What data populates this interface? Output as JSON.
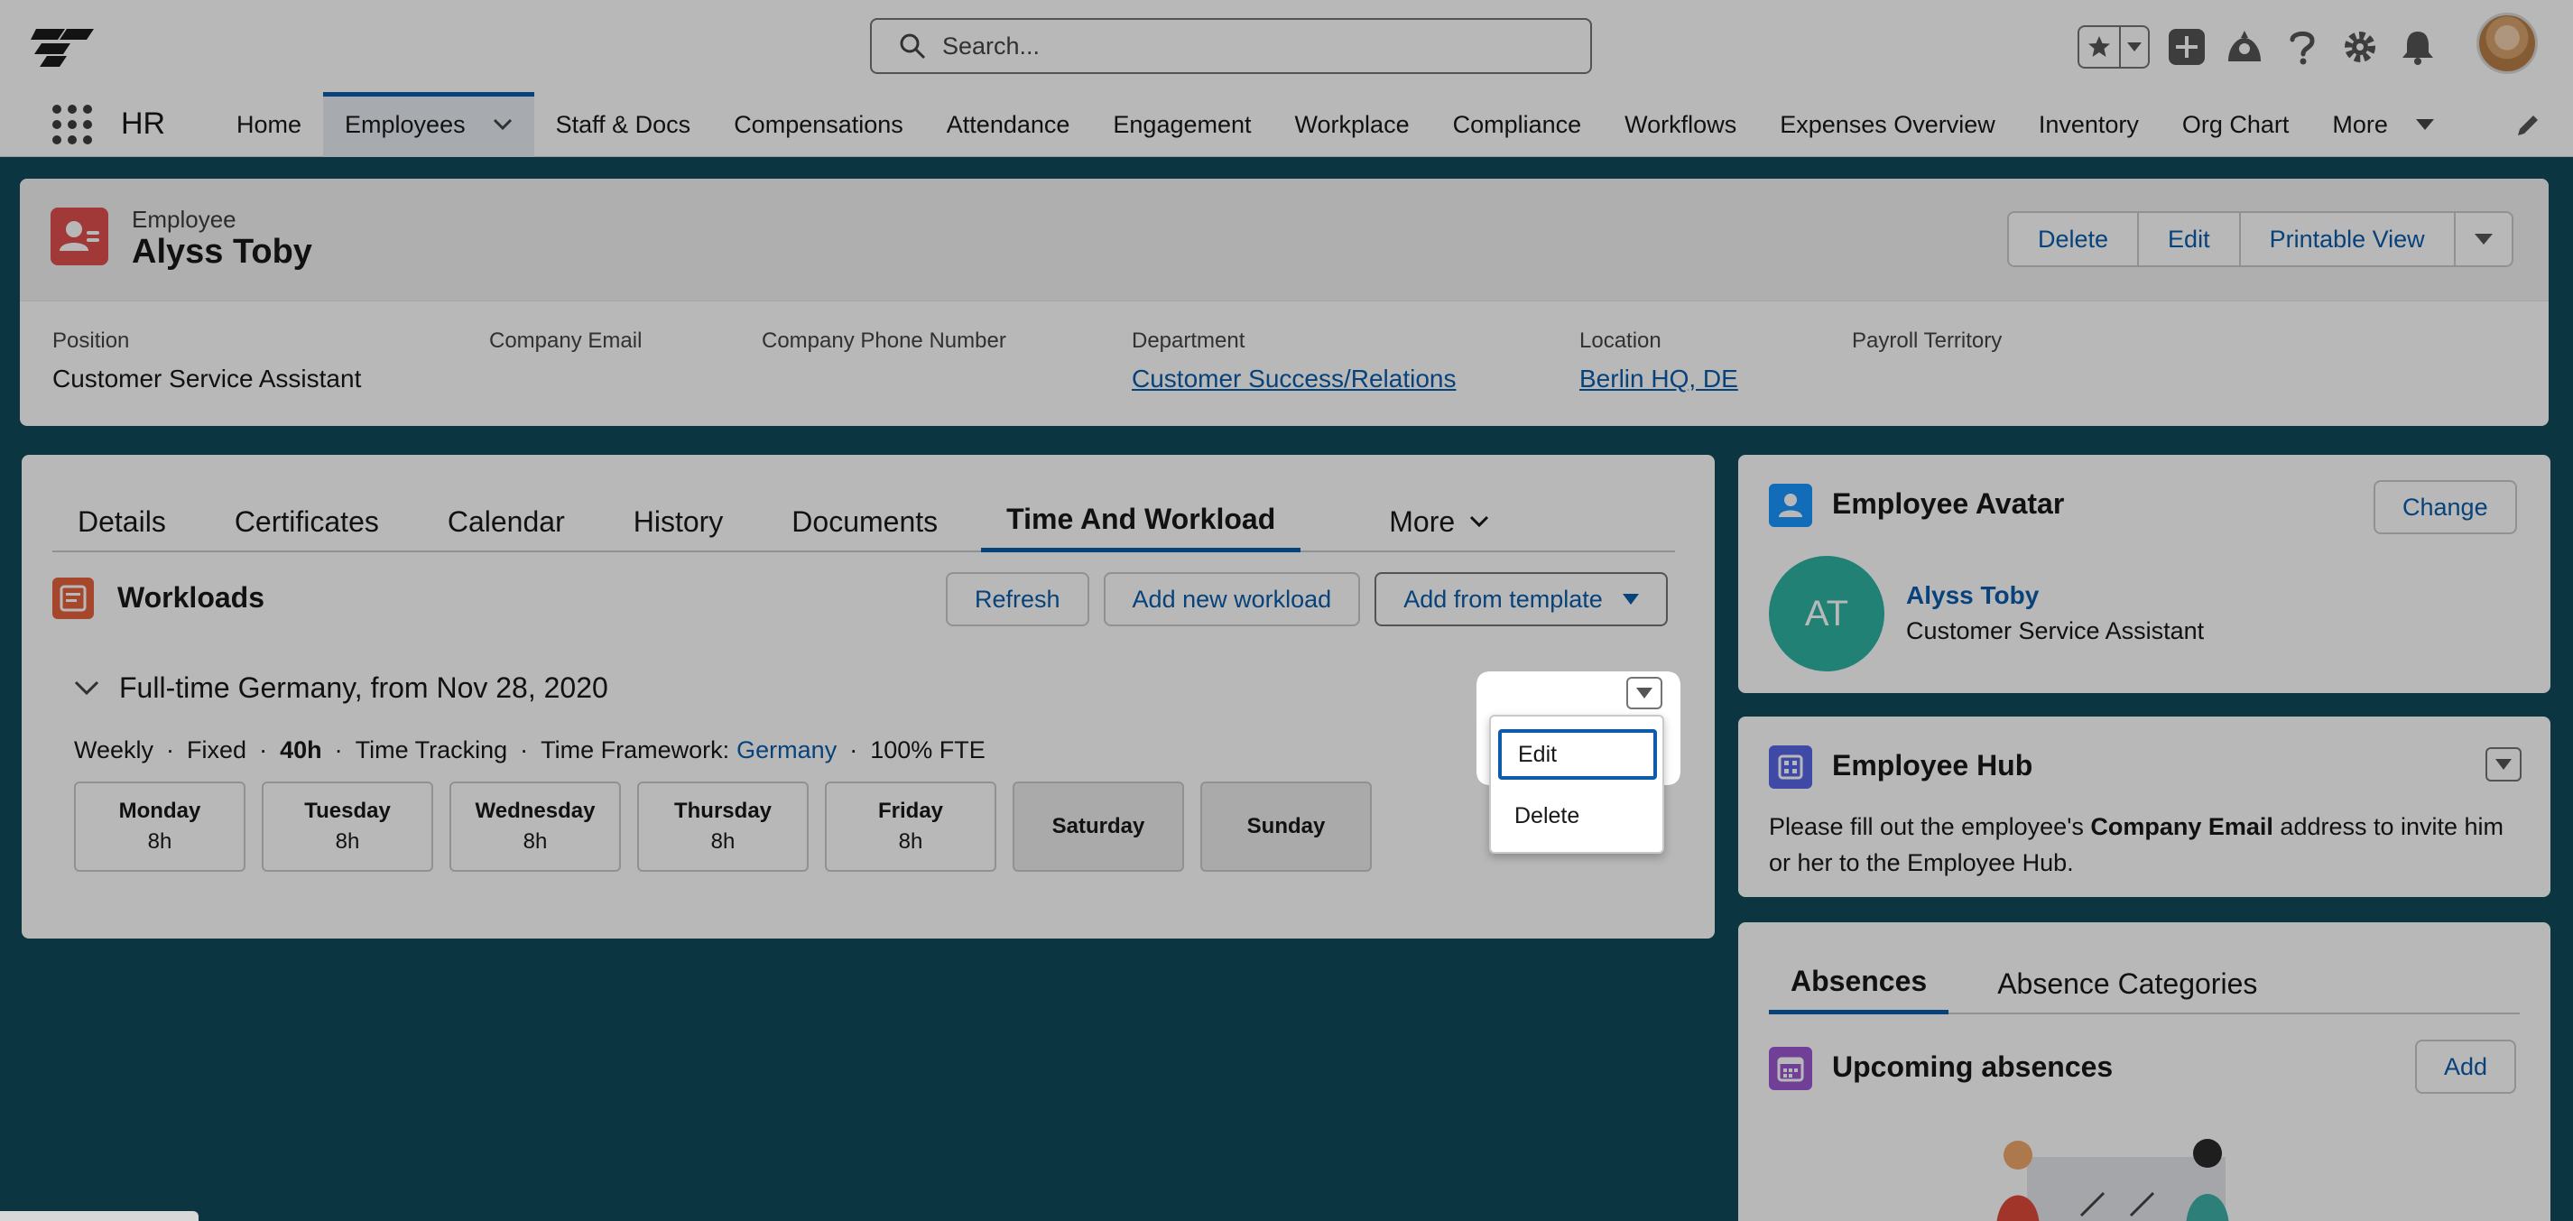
{
  "header": {
    "search_placeholder": "Search...",
    "icons": [
      "favorites-star-icon",
      "add-icon",
      "trailhead-icon",
      "help-icon",
      "settings-gear-icon",
      "notification-bell-icon"
    ]
  },
  "nav": {
    "app_name": "HR",
    "items": [
      "Home",
      "Employees",
      "Staff & Docs",
      "Compensations",
      "Attendance",
      "Engagement",
      "Workplace",
      "Compliance",
      "Workflows",
      "Expenses Overview",
      "Inventory",
      "Org Chart",
      "More"
    ],
    "active_index": 1
  },
  "record": {
    "type": "Employee",
    "name": "Alyss Toby",
    "actions": {
      "delete": "Delete",
      "edit": "Edit",
      "printable": "Printable View"
    },
    "fields": [
      {
        "label": "Position",
        "value": "Customer Service Assistant"
      },
      {
        "label": "Company Email",
        "value": ""
      },
      {
        "label": "Company Phone Number",
        "value": ""
      },
      {
        "label": "Department",
        "value": "Customer Success/Relations"
      },
      {
        "label": "Location",
        "value": "Berlin HQ, DE"
      },
      {
        "label": "Payroll Territory",
        "value": ""
      }
    ]
  },
  "tabs": {
    "items": [
      "Details",
      "Certificates",
      "Calendar",
      "History",
      "Documents",
      "Time And Workload"
    ],
    "more": "More",
    "active_index": 5
  },
  "workloads": {
    "title": "Workloads",
    "refresh": "Refresh",
    "add_new": "Add new workload",
    "add_template": "Add from template",
    "entry_title": "Full-time Germany, from Nov 28, 2020",
    "meta": {
      "period": "Weekly",
      "type": "Fixed",
      "hours": "40h",
      "tracking": "Time Tracking",
      "framework_label": "Time Framework:",
      "framework_value": "Germany",
      "fte": "100% FTE"
    },
    "days": [
      {
        "name": "Monday",
        "hours": "8h"
      },
      {
        "name": "Tuesday",
        "hours": "8h"
      },
      {
        "name": "Wednesday",
        "hours": "8h"
      },
      {
        "name": "Thursday",
        "hours": "8h"
      },
      {
        "name": "Friday",
        "hours": "8h"
      },
      {
        "name": "Saturday",
        "hours": ""
      },
      {
        "name": "Sunday",
        "hours": ""
      }
    ],
    "menu": {
      "edit": "Edit",
      "delete": "Delete"
    }
  },
  "avatar_card": {
    "title": "Employee Avatar",
    "change": "Change",
    "initials": "AT",
    "name": "Alyss Toby",
    "position": "Customer Service Assistant"
  },
  "hub_card": {
    "title": "Employee Hub",
    "text_before": "Please fill out the employee's ",
    "text_bold": "Company Email",
    "text_after": " address to invite him or her to the Employee Hub."
  },
  "absences_card": {
    "tabs": [
      "Absences",
      "Absence Categories"
    ],
    "active_index": 0,
    "title": "Upcoming absences",
    "add": "Add"
  },
  "colors": {
    "brand_blue": "#0b5cab",
    "background_teal": "#0e4a5b",
    "employee_icon": "#e14f4f",
    "workload_icon": "#e6623c",
    "avatar_icon": "#2fb3a3",
    "overlay": "rgba(0,0,0,0.28)"
  }
}
